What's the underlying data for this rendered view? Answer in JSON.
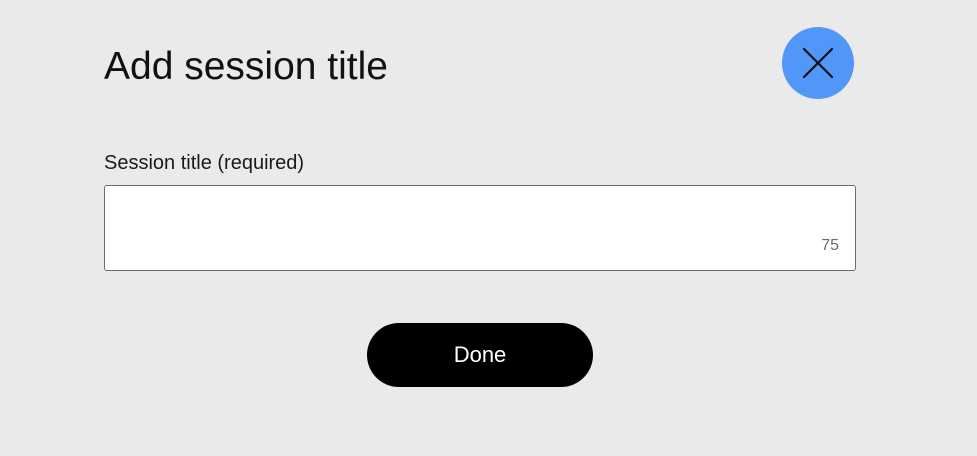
{
  "dialog": {
    "title": "Add session title",
    "close_icon": "close-icon",
    "field": {
      "label": "Session title (required)",
      "value": "",
      "placeholder": "",
      "char_count": "75"
    },
    "done_label": "Done"
  },
  "colors": {
    "background": "#ebeaeb",
    "close_button": "#5196f9",
    "done_button": "#000000",
    "input_border": "#6d6d6d"
  }
}
